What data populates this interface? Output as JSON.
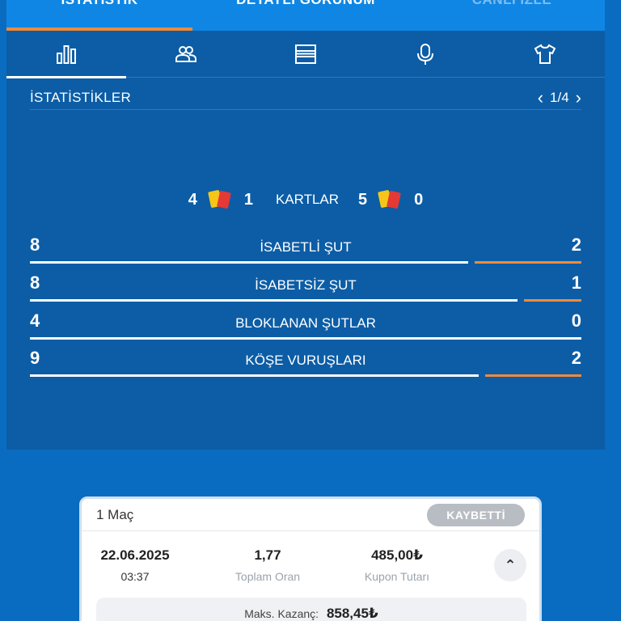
{
  "top_tabs": [
    "İSTATİSTİK",
    "DETAYLI GÖRÜNÜM",
    "CANLI İZLE"
  ],
  "icon_tabs": [
    "bar-chart-icon",
    "players-icon",
    "list-icon",
    "microphone-icon",
    "jersey-icon"
  ],
  "section": {
    "title": "İSTATİSTİKLER",
    "pager": "1/4"
  },
  "cards": {
    "home_yellow": "4",
    "home_red": "1",
    "label": "KARTLAR",
    "away_yellow": "5",
    "away_red": "0"
  },
  "stats": [
    {
      "label": "İSABETLİ ŞUT",
      "home": "8",
      "away": "2",
      "home_share": 0.8,
      "away_share": 0.2
    },
    {
      "label": "İSABETSİZ ŞUT",
      "home": "8",
      "away": "1",
      "home_share": 0.89,
      "away_share": 0.11
    },
    {
      "label": "BLOKLANAN ŞUTLAR",
      "home": "4",
      "away": "0",
      "home_share": 1.0,
      "away_share": 0.0
    },
    {
      "label": "KÖŞE VURUŞLARI",
      "home": "9",
      "away": "2",
      "home_share": 0.82,
      "away_share": 0.18
    }
  ],
  "coupon": {
    "match_count": "1 Maç",
    "status": "KAYBETTİ",
    "date": "22.06.2025",
    "time": "03:37",
    "total_odds": "1,77",
    "total_odds_label": "Toplam Oran",
    "stake": "485,00₺",
    "stake_label": "Kupon Tutarı",
    "max_win_label": "Maks. Kazanç:",
    "max_win": "858,45₺"
  },
  "colors": {
    "accent": "#f08a3a",
    "panel": "#0c5da6",
    "background": "#0a6cc0"
  }
}
